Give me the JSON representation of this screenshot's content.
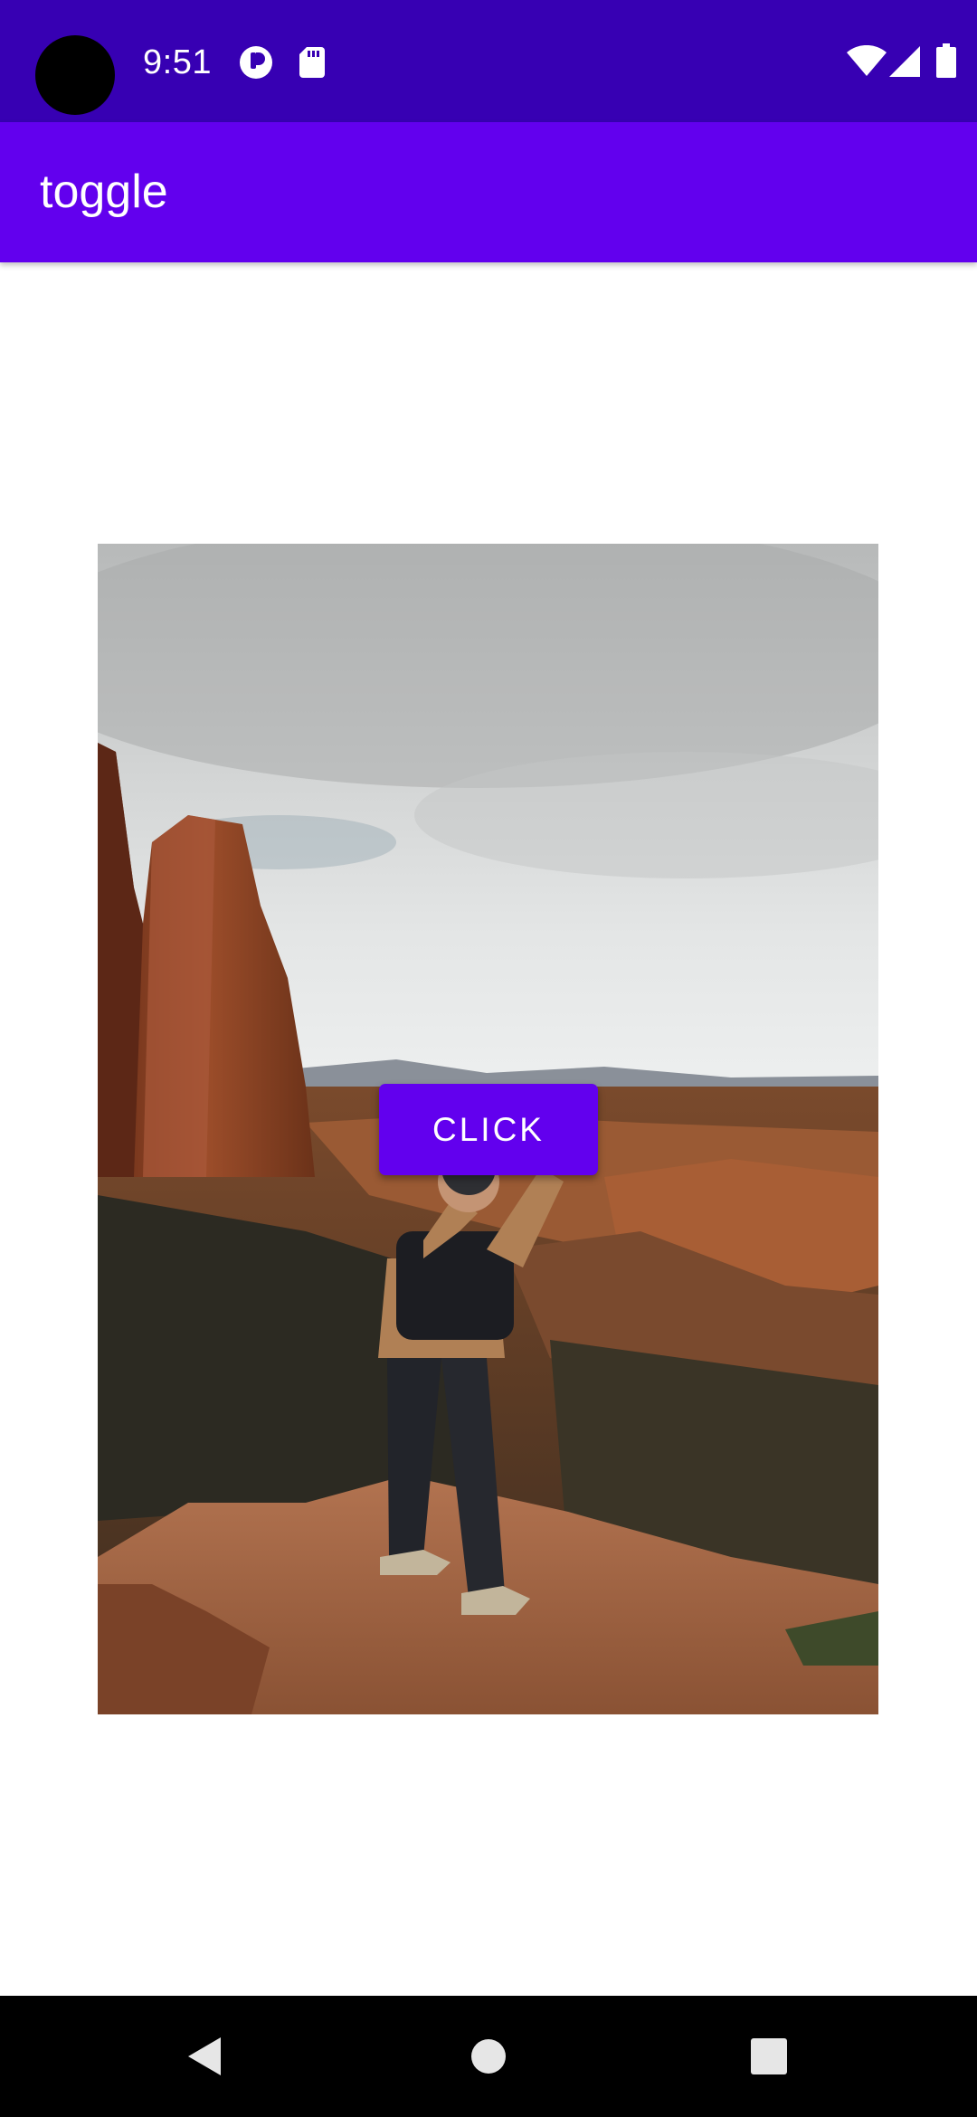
{
  "status_bar": {
    "time": "9:51",
    "icons": [
      "camera-cutout",
      "notification-app-icon",
      "sd-card-icon",
      "wifi-icon",
      "cell-signal-icon",
      "battery-icon"
    ],
    "background_color": "#3700b3"
  },
  "app_bar": {
    "title": "toggle",
    "background_color": "#6200ee"
  },
  "content": {
    "image_description_icon": "photo-of-hiker-photographing-red-rock-canyon",
    "button_label": "CLICK",
    "button_color": "#6200ee"
  },
  "nav_bar": {
    "buttons": [
      "back-icon",
      "home-icon",
      "recents-icon"
    ]
  }
}
